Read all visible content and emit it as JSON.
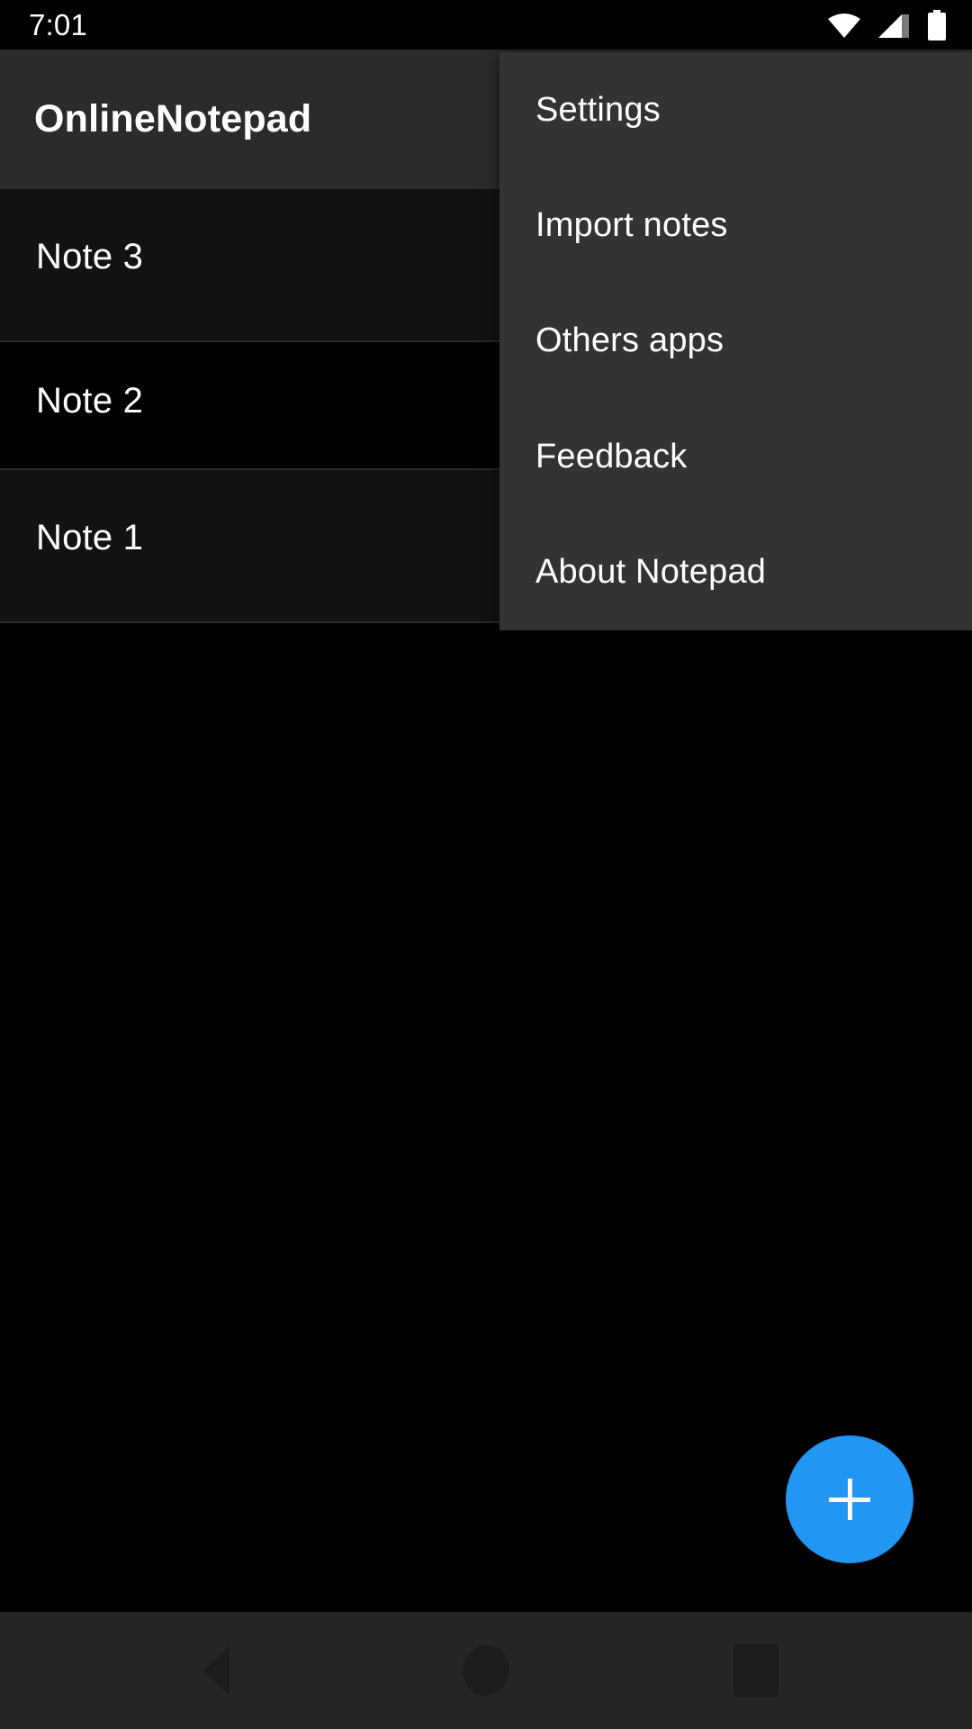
{
  "status_bar": {
    "time": "7:01",
    "icons": [
      {
        "name": "wifi-icon",
        "label": "wifi"
      },
      {
        "name": "cellular-signal-icon",
        "label": "signal"
      },
      {
        "name": "battery-icon",
        "label": "battery"
      }
    ]
  },
  "app_bar": {
    "title": "OnlineNotepad"
  },
  "note_list": {
    "items": [
      {
        "title": "Note 3"
      },
      {
        "title": "Note 2"
      },
      {
        "title": "Note 1"
      }
    ]
  },
  "overflow_menu": {
    "items": [
      {
        "label": "Settings"
      },
      {
        "label": "Import notes"
      },
      {
        "label": "Others apps"
      },
      {
        "label": "Feedback"
      },
      {
        "label": "About Notepad"
      }
    ]
  },
  "fab": {
    "label": "+",
    "color": "#2196f3"
  },
  "nav_bar": {
    "back": "back",
    "home": "home",
    "recents": "recents"
  },
  "colors": {
    "app_bar_bg": "#2b2b2b",
    "menu_bg": "#333333",
    "row_bg": "#121212",
    "row_alt_bg": "#000000",
    "accent": "#2196f3",
    "nav_bg": "#252525"
  }
}
